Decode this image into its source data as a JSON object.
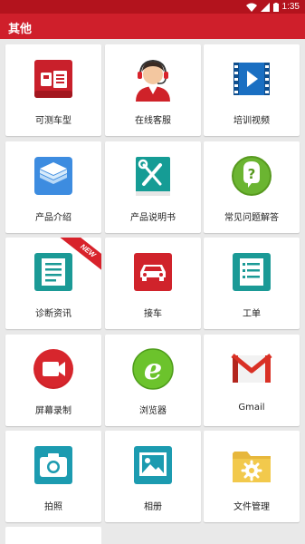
{
  "status_bar": {
    "time": "1:35",
    "icons": [
      "wifi-icon",
      "signal-icon",
      "battery-icon"
    ]
  },
  "app_bar": {
    "title": "其他"
  },
  "colors": {
    "app_bar": "#cf1f2b",
    "status_bar": "#b3131d",
    "background": "#e9e9e9"
  },
  "tiles": [
    {
      "label": "可测车型",
      "icon": "vehicle-list-icon"
    },
    {
      "label": "在线客服",
      "icon": "customer-service-icon"
    },
    {
      "label": "培训视频",
      "icon": "video-icon"
    },
    {
      "label": "产品介绍",
      "icon": "layers-icon"
    },
    {
      "label": "产品说明书",
      "icon": "manual-tools-icon"
    },
    {
      "label": "常见问题解答",
      "icon": "question-icon"
    },
    {
      "label": "诊断资讯",
      "icon": "news-icon",
      "badge": "NEW"
    },
    {
      "label": "接车",
      "icon": "car-icon"
    },
    {
      "label": "工单",
      "icon": "checklist-icon"
    },
    {
      "label": "屏幕录制",
      "icon": "screen-record-icon"
    },
    {
      "label": "浏览器",
      "icon": "browser-icon"
    },
    {
      "label": "Gmail",
      "icon": "gmail-icon"
    },
    {
      "label": "拍照",
      "icon": "camera-icon"
    },
    {
      "label": "相册",
      "icon": "gallery-icon"
    },
    {
      "label": "文件管理",
      "icon": "file-manager-icon"
    }
  ]
}
